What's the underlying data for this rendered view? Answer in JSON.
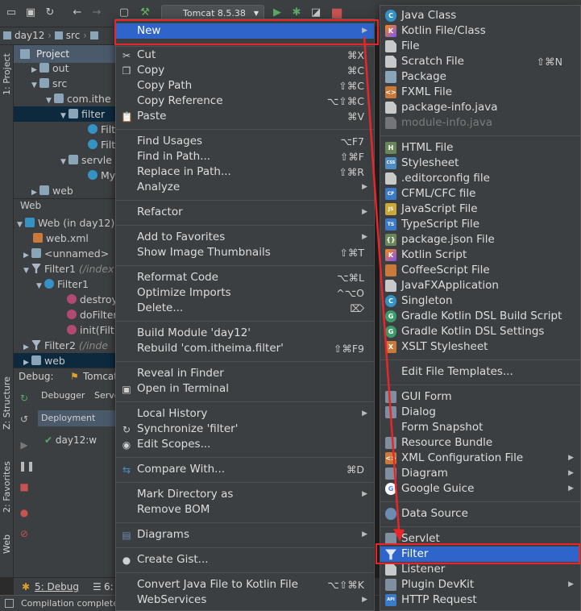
{
  "toolbar": {
    "run_config": "Tomcat 8.5.38"
  },
  "breadcrumb": {
    "items": [
      "day12",
      "src"
    ]
  },
  "side_tabs": {
    "project": "1: Project",
    "structure": "Z: Structure",
    "favorites": "2: Favorites",
    "web": "Web"
  },
  "project_panel": {
    "header": "Project",
    "tree": [
      {
        "label": "out",
        "icon": "folder-icon"
      },
      {
        "label": "src",
        "icon": "folder-icon"
      },
      {
        "label": "com.ithe",
        "icon": "package-icon"
      },
      {
        "label": "filter",
        "icon": "package-icon"
      },
      {
        "label": "Filt",
        "icon": "class-icon"
      },
      {
        "label": "Filt",
        "icon": "class-icon"
      },
      {
        "label": "servle",
        "icon": "package-icon"
      },
      {
        "label": "My",
        "icon": "class-icon"
      },
      {
        "label": "web",
        "icon": "folder-icon"
      }
    ]
  },
  "web_panel": {
    "title": "Web",
    "tree": [
      {
        "label": "Web (in day12)"
      },
      {
        "label": "web.xml"
      },
      {
        "label": "<unnamed>"
      },
      {
        "label": "Filter1",
        "suffix": "(/index"
      },
      {
        "label": "Filter1"
      },
      {
        "label": "destroy"
      },
      {
        "label": "doFilter"
      },
      {
        "label": "init(Filt"
      },
      {
        "label": "Filter2",
        "suffix": "(/inde"
      },
      {
        "label": "web"
      }
    ]
  },
  "debug_panel": {
    "label": "Debug:",
    "config": "Tomcat",
    "tabs": [
      "Debugger",
      "Server"
    ],
    "deployment_header": "Deployment",
    "deployment_item": "day12:w"
  },
  "bottom_tabs": {
    "debug": "5: Debug",
    "other": "6:"
  },
  "status_bar": {
    "text": "Compilation completed"
  },
  "context_menu": {
    "items": [
      {
        "label": "New",
        "shortcut": "",
        "submenu": true,
        "highlighted": true
      },
      {
        "label": "Cut",
        "shortcut": "⌘X",
        "icon": "scissors-icon"
      },
      {
        "label": "Copy",
        "shortcut": "⌘C",
        "icon": "copy-icon"
      },
      {
        "label": "Copy Path",
        "shortcut": "⇧⌘C"
      },
      {
        "label": "Copy Reference",
        "shortcut": "⌥⇧⌘C"
      },
      {
        "label": "Paste",
        "shortcut": "⌘V",
        "icon": "paste-icon"
      },
      {
        "label": "Find Usages",
        "shortcut": "⌥F7"
      },
      {
        "label": "Find in Path...",
        "shortcut": "⇧⌘F"
      },
      {
        "label": "Replace in Path...",
        "shortcut": "⇧⌘R"
      },
      {
        "label": "Analyze",
        "submenu": true
      },
      {
        "label": "Refactor",
        "submenu": true
      },
      {
        "label": "Add to Favorites",
        "submenu": true
      },
      {
        "label": "Show Image Thumbnails",
        "shortcut": "⇧⌘T"
      },
      {
        "label": "Reformat Code",
        "shortcut": "⌥⌘L"
      },
      {
        "label": "Optimize Imports",
        "shortcut": "^⌥O"
      },
      {
        "label": "Delete...",
        "shortcut": "⌦"
      },
      {
        "label": "Build Module 'day12'"
      },
      {
        "label": "Rebuild 'com.itheima.filter'",
        "shortcut": "⇧⌘F9"
      },
      {
        "label": "Reveal in Finder"
      },
      {
        "label": "Open in Terminal",
        "icon": "terminal-icon"
      },
      {
        "label": "Local History",
        "submenu": true
      },
      {
        "label": "Synchronize 'filter'",
        "icon": "sync-icon"
      },
      {
        "label": "Edit Scopes...",
        "icon": "scope-icon"
      },
      {
        "label": "Compare With...",
        "shortcut": "⌘D",
        "icon": "compare-icon"
      },
      {
        "label": "Mark Directory as",
        "submenu": true
      },
      {
        "label": "Remove BOM"
      },
      {
        "label": "Diagrams",
        "submenu": true,
        "icon": "diagram-icon"
      },
      {
        "label": "Create Gist...",
        "icon": "github-icon"
      },
      {
        "label": "Convert Java File to Kotlin File",
        "shortcut": "⌥⇧⌘K"
      },
      {
        "label": "WebServices",
        "submenu": true
      }
    ]
  },
  "new_submenu": {
    "items": [
      {
        "label": "Java Class",
        "icon": "java-class-icon",
        "glyph": "C"
      },
      {
        "label": "Kotlin File/Class",
        "icon": "kotlin-icon",
        "glyph": "K"
      },
      {
        "label": "File",
        "icon": "file-icon",
        "glyph": ""
      },
      {
        "label": "Scratch File",
        "shortcut": "⇧⌘N",
        "icon": "scratch-file-icon",
        "glyph": ""
      },
      {
        "label": "Package",
        "icon": "package-icon",
        "glyph": ""
      },
      {
        "label": "FXML File",
        "icon": "fxml-icon",
        "glyph": "<>"
      },
      {
        "label": "package-info.java",
        "icon": "package-info-icon",
        "glyph": ""
      },
      {
        "label": "module-info.java",
        "icon": "module-info-icon",
        "glyph": "",
        "disabled": true
      },
      {
        "label": "HTML File",
        "icon": "html-icon",
        "glyph": "H"
      },
      {
        "label": "Stylesheet",
        "icon": "css-icon",
        "glyph": "CSS"
      },
      {
        "label": ".editorconfig file",
        "icon": "editorconfig-icon",
        "glyph": ""
      },
      {
        "label": "CFML/CFC file",
        "icon": "cfml-icon",
        "glyph": "CF"
      },
      {
        "label": "JavaScript File",
        "icon": "javascript-icon",
        "glyph": "JS"
      },
      {
        "label": "TypeScript File",
        "icon": "typescript-icon",
        "glyph": "TS"
      },
      {
        "label": "package.json File",
        "icon": "package-json-icon",
        "glyph": "{}"
      },
      {
        "label": "Kotlin Script",
        "icon": "kotlin-script-icon",
        "glyph": "K"
      },
      {
        "label": "CoffeeScript File",
        "icon": "coffeescript-icon",
        "glyph": ""
      },
      {
        "label": "JavaFXApplication",
        "icon": "javafx-icon",
        "glyph": ""
      },
      {
        "label": "Singleton",
        "icon": "singleton-icon",
        "glyph": "C"
      },
      {
        "label": "Gradle Kotlin DSL Build Script",
        "icon": "gradle-icon",
        "glyph": "G"
      },
      {
        "label": "Gradle Kotlin DSL Settings",
        "icon": "gradle-icon",
        "glyph": "G"
      },
      {
        "label": "XSLT Stylesheet",
        "icon": "xslt-icon",
        "glyph": "X"
      },
      {
        "label": "Edit File Templates..."
      },
      {
        "label": "GUI Form",
        "icon": "gui-form-icon",
        "glyph": ""
      },
      {
        "label": "Dialog",
        "icon": "dialog-icon",
        "glyph": ""
      },
      {
        "label": "Form Snapshot"
      },
      {
        "label": "Resource Bundle",
        "icon": "resource-bundle-icon",
        "glyph": ""
      },
      {
        "label": "XML Configuration File",
        "icon": "xml-icon",
        "glyph": "<>",
        "submenu": true
      },
      {
        "label": "Diagram",
        "icon": "diagram-icon",
        "glyph": "",
        "submenu": true
      },
      {
        "label": "Google Guice",
        "icon": "google-guice-icon",
        "glyph": "G",
        "submenu": true
      },
      {
        "label": "Data Source",
        "icon": "database-icon",
        "glyph": ""
      },
      {
        "label": "Servlet",
        "icon": "servlet-icon",
        "glyph": ""
      },
      {
        "label": "Filter",
        "icon": "filter-icon",
        "glyph": "",
        "highlighted": true
      },
      {
        "label": "Listener",
        "icon": "listener-icon",
        "glyph": ""
      },
      {
        "label": "Plugin DevKit",
        "icon": "plugin-devkit-icon",
        "glyph": "",
        "submenu": true
      },
      {
        "label": "HTTP Request",
        "icon": "http-request-icon",
        "glyph": "API"
      }
    ]
  },
  "colors": {
    "highlight": "#2f65ca",
    "annotation_red": "#e8262a",
    "menu_bg": "#3c3f41"
  }
}
